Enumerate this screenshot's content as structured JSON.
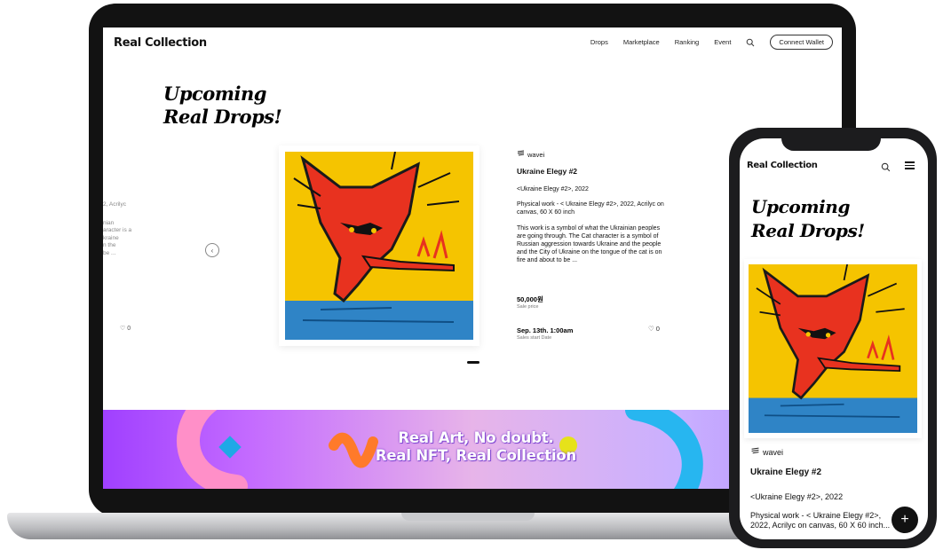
{
  "laptop": {
    "logo": "Real Collection",
    "nav": {
      "drops": "Drops",
      "marketplace": "Marketplace",
      "ranking": "Ranking",
      "event": "Event",
      "connect_wallet": "Connect Wallet"
    },
    "hero_title_line1": "Upcoming",
    "hero_title_line2": "Real Drops!",
    "side_ghost": {
      "line1": "2, Acrilyc",
      "line2": "nian",
      "line3": "aracter is a",
      "line4": "kraine",
      "line5": "n the",
      "line6": "be ...",
      "likes": "0"
    },
    "artwork": {
      "artist": "wavei",
      "title": "Ukraine Elegy #2",
      "subtitle": "<Ukraine Elegy #2>, 2022",
      "spec": "Physical work - < Ukraine Elegy #2>, 2022, Acrilyc on canvas, 60 X 60 inch",
      "description": "This work is a symbol of what the Ukrainian peoples are going through. The Cat character is a symbol of Russian aggression towards Ukraine and the people and the City of Ukraine on the tongue of the cat is on fire and about to be ...",
      "price": "50,000원",
      "price_label": "Sale price",
      "date": "Sep. 13th. 1:00am",
      "date_label": "Sales start Date",
      "likes": "0"
    },
    "banner": {
      "line1": "Real Art, No doubt.",
      "line2": "Real NFT, Real Collection"
    }
  },
  "phone": {
    "logo": "Real Collection",
    "hero_title_line1": "Upcoming",
    "hero_title_line2": "Real Drops!",
    "artist": "wavei",
    "title": "Ukraine Elegy #2",
    "subtitle": "<Ukraine Elegy #2>, 2022",
    "spec": "Physical work - < Ukraine Elegy #2>, 2022, Acrilyc on canvas, 60 X 60 inch...",
    "fab": "+"
  },
  "colors": {
    "art_yellow": "#f5c400",
    "art_blue": "#2f84c6",
    "cat_red": "#e8321f",
    "banner_purple": "#a040ff"
  },
  "icons": [
    "search-icon",
    "menu-icon",
    "heart-icon",
    "chevron-left-icon",
    "artist-icon",
    "plus-icon"
  ]
}
